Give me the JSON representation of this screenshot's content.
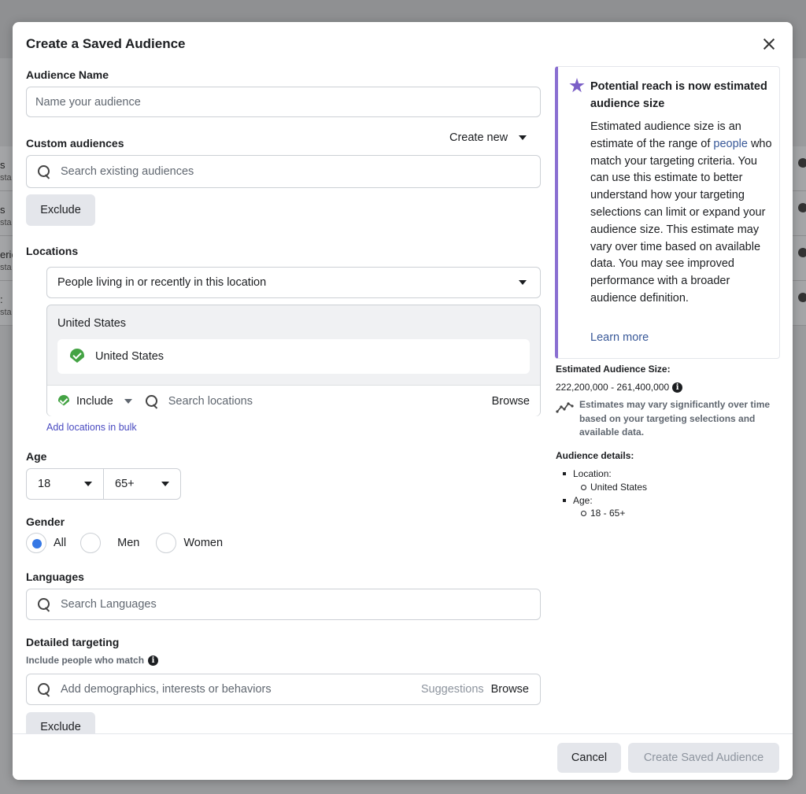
{
  "modal": {
    "title": "Create a Saved Audience"
  },
  "audience_name": {
    "label": "Audience Name",
    "placeholder": "Name your audience"
  },
  "custom_audiences": {
    "label": "Custom audiences",
    "create_new": "Create new",
    "placeholder": "Search existing audiences",
    "exclude": "Exclude"
  },
  "locations": {
    "label": "Locations",
    "mode": "People living in or recently in this location",
    "group": "United States",
    "selected": "United States",
    "include": "Include",
    "search_placeholder": "Search locations",
    "browse": "Browse",
    "bulk_link": "Add locations in bulk"
  },
  "age": {
    "label": "Age",
    "min": "18",
    "max": "65+"
  },
  "gender": {
    "label": "Gender",
    "options": [
      "All",
      "Men",
      "Women"
    ],
    "selected": "All"
  },
  "languages": {
    "label": "Languages",
    "placeholder": "Search Languages"
  },
  "detailed_targeting": {
    "label": "Detailed targeting",
    "sublabel": "Include people who match",
    "placeholder": "Add demographics, interests or behaviors",
    "suggestions": "Suggestions",
    "browse": "Browse",
    "exclude": "Exclude"
  },
  "footer": {
    "cancel": "Cancel",
    "create": "Create Saved Audience"
  },
  "notice": {
    "title": "Potential reach is now estimated audience size",
    "body_before": "Estimated audience size is an estimate of the range of ",
    "body_link": "people",
    "body_after": " who match your targeting criteria. You can use this estimate to better understand how your targeting selections can limit or expand your audience size. This estimate may vary over time based on available data. You may see improved performance with a broader audience definition.",
    "learn_more": "Learn more"
  },
  "estimate": {
    "label": "Estimated Audience Size:",
    "range": "222,200,000 - 261,400,000",
    "note": "Estimates may vary significantly over time based on your targeting selections and available data."
  },
  "details": {
    "label": "Audience details:",
    "location_label": "Location:",
    "location_value": "United States",
    "age_label": "Age:",
    "age_value": "18 - 65+"
  },
  "background": {
    "rows": [
      {
        "l1": "s",
        "l2": "sta"
      },
      {
        "l1": "s",
        "l2": "sta"
      },
      {
        "l1": "eric",
        "l2": "sta"
      },
      {
        "l1": ":",
        "l2": "sta"
      }
    ]
  },
  "colors": {
    "accent_purple": "#8a6fd1",
    "link_blue": "#385898",
    "radio_blue": "#3578e5",
    "pin_green": "#44a344"
  }
}
